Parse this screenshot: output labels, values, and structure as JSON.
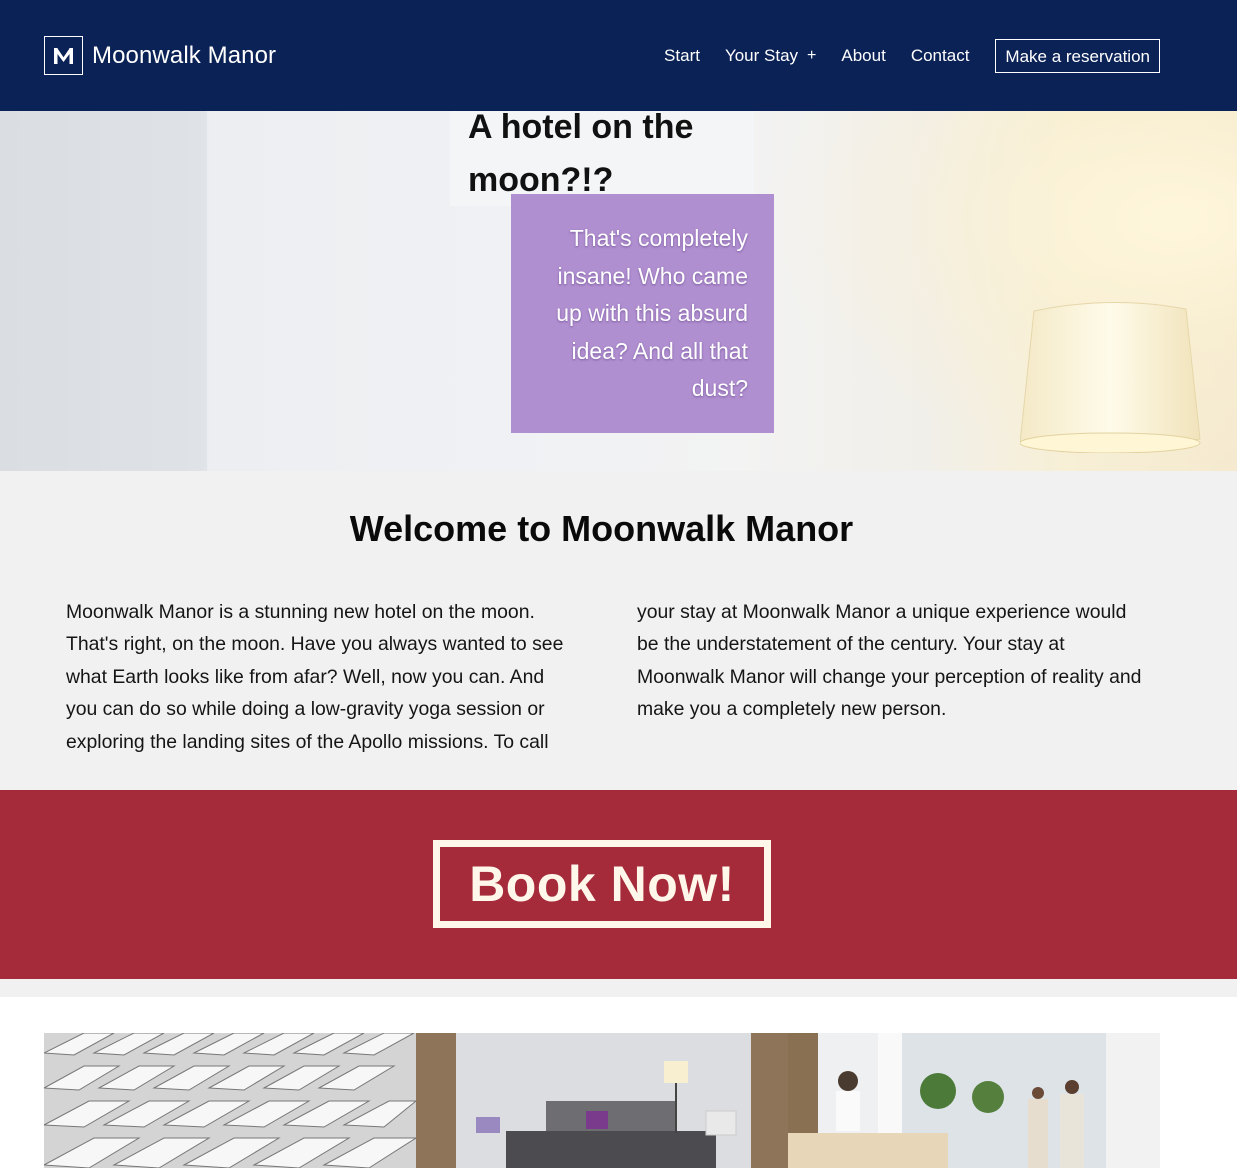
{
  "brand": {
    "name": "Moonwalk Manor",
    "logo_letter": "M"
  },
  "nav": {
    "items": [
      {
        "label": "Start"
      },
      {
        "label": "Your Stay",
        "expand": "+"
      },
      {
        "label": "About"
      },
      {
        "label": "Contact"
      }
    ],
    "cta_label": "Make a reservation"
  },
  "hero": {
    "title": "A hotel on the moon?!?",
    "subtitle": "That's completely insane! Who came up with this absurd idea? And all that dust?"
  },
  "welcome": {
    "title": "Welcome to Moonwalk Manor",
    "body": "Moonwalk Manor is a stunning new hotel on the moon. That's right, on the moon. Have you always wanted to see what Earth looks like from afar? Well, now you can. And you can do so while doing a low-gravity yoga session or exploring the landing sites of the Apollo missions. To call your stay at Moonwalk Manor a unique experience would be the understatement of the century. Your stay at Moonwalk Manor will change your perception of reality and make you a completely new person."
  },
  "book": {
    "label": "Book Now!"
  },
  "colors": {
    "header_bg": "#0b2256",
    "hero_subtitle_bg": "#b08fd0",
    "book_band_bg": "#a62b3a",
    "book_button_fg": "#fff7ea",
    "page_bg": "#f1f1f1"
  }
}
